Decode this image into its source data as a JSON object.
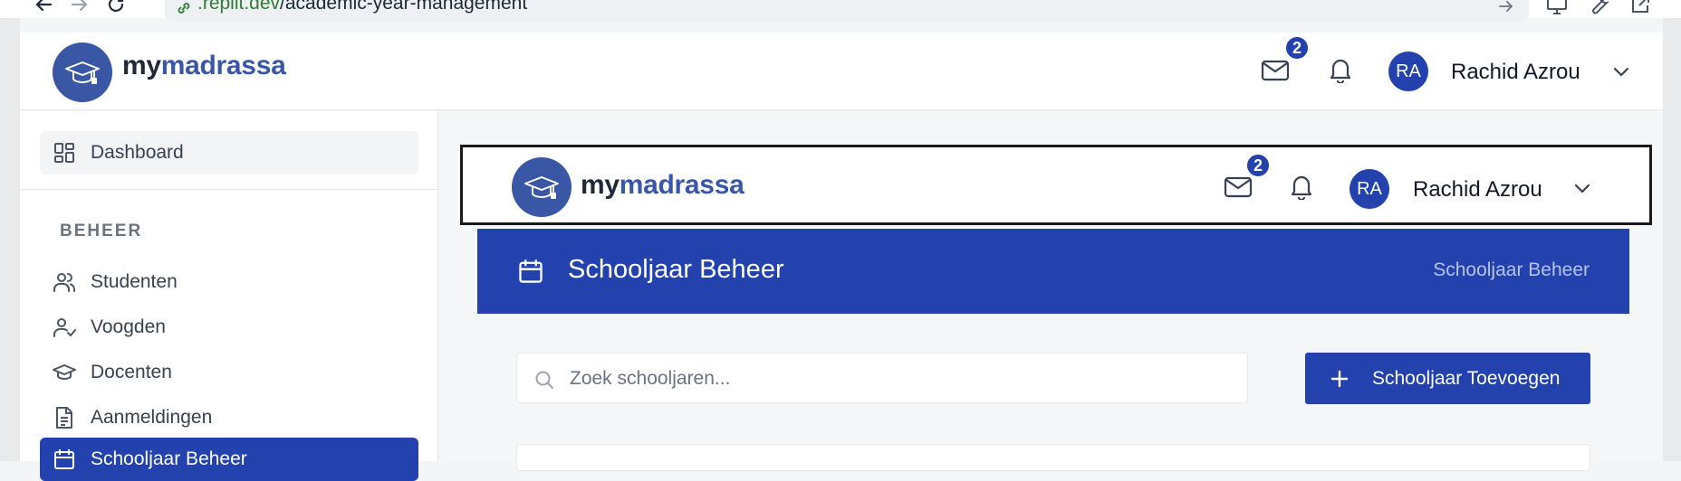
{
  "browser": {
    "url_host": ".replit.dev",
    "url_path": "/academic-year-management"
  },
  "brand": {
    "prefix": "my",
    "name": "madrassa"
  },
  "header": {
    "messages_badge": "2",
    "user_initials": "RA",
    "user_name": "Rachid Azrou"
  },
  "sidebar": {
    "dashboard_label": "Dashboard",
    "section_label": "BEHEER",
    "items": [
      {
        "label": "Studenten",
        "icon": "users-icon"
      },
      {
        "label": "Voogden",
        "icon": "user-check-icon"
      },
      {
        "label": "Docenten",
        "icon": "graduation-cap-icon"
      },
      {
        "label": "Aanmeldingen",
        "icon": "file-text-icon"
      },
      {
        "label": "Schooljaar Beheer",
        "icon": "calendar-icon",
        "active": true
      }
    ]
  },
  "page": {
    "title": "Schooljaar Beheer",
    "breadcrumb": "Schooljaar Beheer",
    "search_placeholder": "Zoek schooljaren...",
    "add_button_label": "Schooljaar Toevoegen"
  },
  "colors": {
    "primary": "#2342ad",
    "logo": "#3a57a6",
    "url_host": "#2e7d32"
  }
}
